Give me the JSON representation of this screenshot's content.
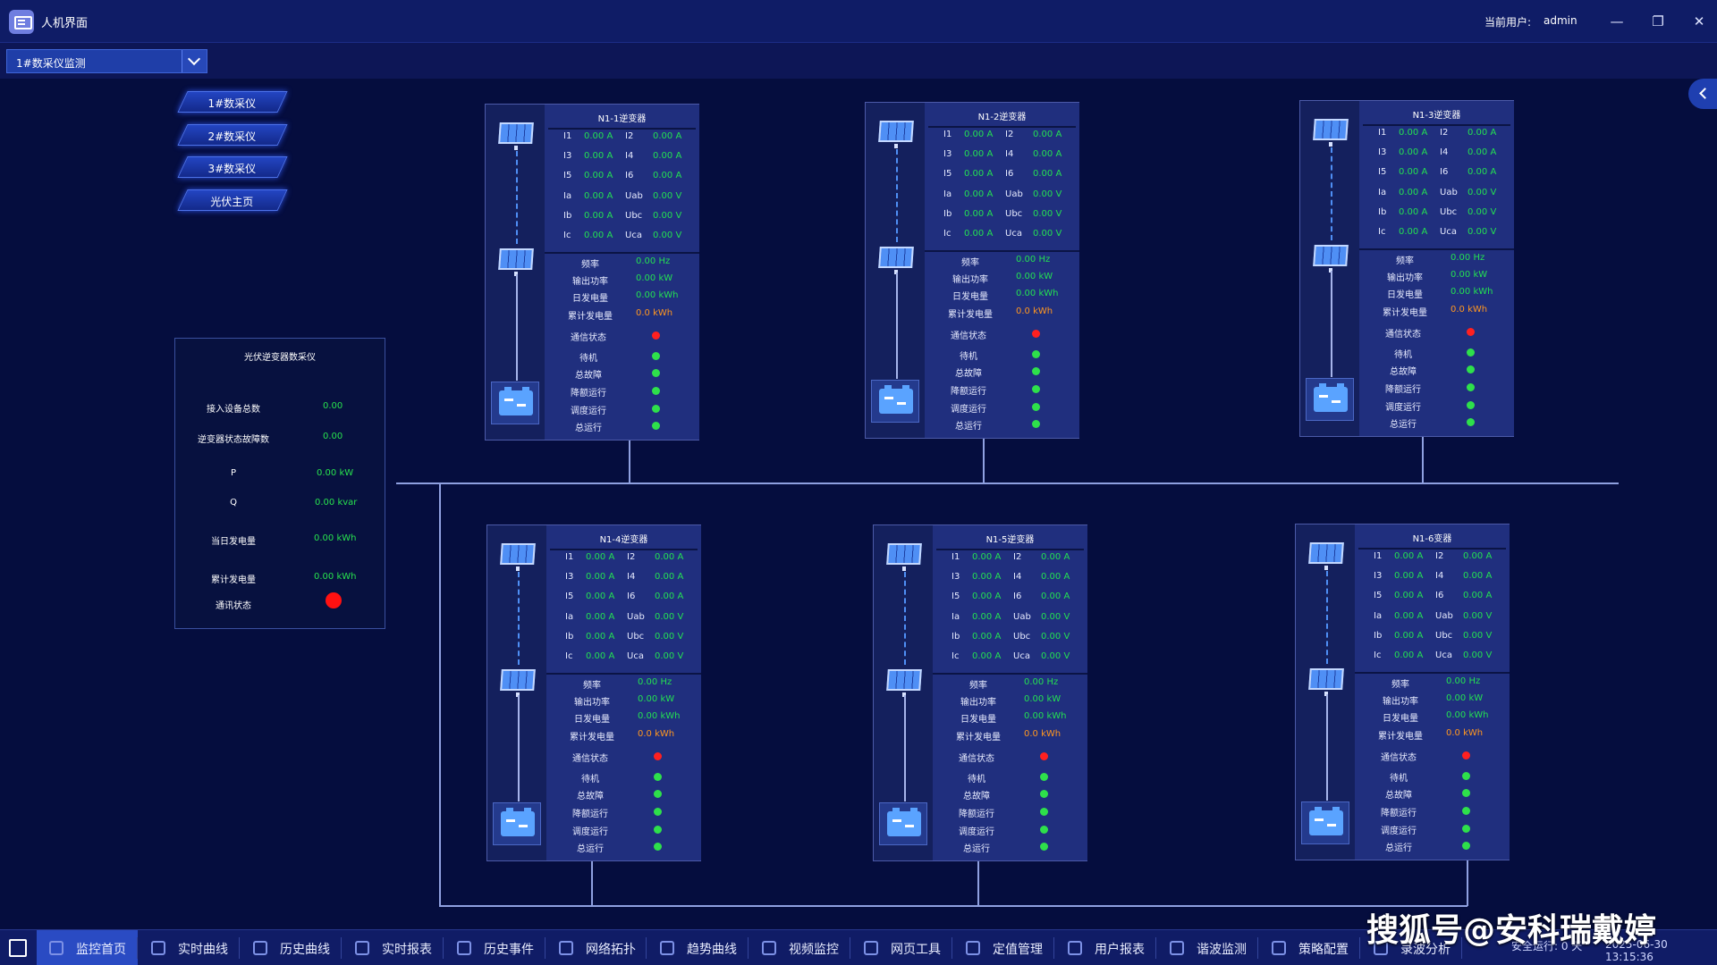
{
  "window": {
    "title": "人机界面",
    "user_label": "当前用户:",
    "user_name": "admin"
  },
  "selector": {
    "value": "1#数采仪监测"
  },
  "nav_buttons": [
    {
      "label": "1#数采仪"
    },
    {
      "label": "2#数采仪"
    },
    {
      "label": "3#数采仪"
    },
    {
      "label": "光伏主页"
    }
  ],
  "summary": {
    "title": "光伏逆变器数采仪",
    "rows": [
      {
        "label": "接入设备总数",
        "value": "0.00"
      },
      {
        "label": "逆变器状态故障数",
        "value": "0.00"
      },
      {
        "label": "P",
        "value": "0.00 kW"
      },
      {
        "label": "Q",
        "value": "0.00 kvar"
      },
      {
        "label": "当日发电量",
        "value": "0.00 kWh"
      },
      {
        "label": "累计发电量",
        "value": "0.00 kWh"
      },
      {
        "label": "通讯状态",
        "value": ""
      }
    ],
    "status_color": "#ff1111"
  },
  "devices": [
    {
      "title": "N1-1逆变器",
      "measurements": [
        {
          "l": "I1",
          "v": "0.00 A",
          "l2": "I2",
          "v2": "0.00 A"
        },
        {
          "l": "I3",
          "v": "0.00 A",
          "l2": "I4",
          "v2": "0.00 A"
        },
        {
          "l": "I5",
          "v": "0.00 A",
          "l2": "I6",
          "v2": "0.00 A"
        },
        {
          "l": "Ia",
          "v": "0.00 A",
          "l2": "Uab",
          "v2": "0.00 V"
        },
        {
          "l": "Ib",
          "v": "0.00 A",
          "l2": "Ubc",
          "v2": "0.00 V"
        },
        {
          "l": "Ic",
          "v": "0.00 A",
          "l2": "Uca",
          "v2": "0.00 V"
        }
      ],
      "energy": [
        {
          "l": "频率",
          "v": "0.00 Hz"
        },
        {
          "l": "输出功率",
          "v": "0.00 kW"
        },
        {
          "l": "日发电量",
          "v": "0.00 kWh"
        },
        {
          "l": "累计发电量",
          "v": "0.0 kWh"
        }
      ],
      "states": [
        "通信状态",
        "待机",
        "总故障",
        "降额运行",
        "调度运行",
        "总运行"
      ]
    },
    {
      "title": "N1-2逆变器",
      "measurements": [
        {
          "l": "I1",
          "v": "0.00 A",
          "l2": "I2",
          "v2": "0.00 A"
        },
        {
          "l": "I3",
          "v": "0.00 A",
          "l2": "I4",
          "v2": "0.00 A"
        },
        {
          "l": "I5",
          "v": "0.00 A",
          "l2": "I6",
          "v2": "0.00 A"
        },
        {
          "l": "Ia",
          "v": "0.00 A",
          "l2": "Uab",
          "v2": "0.00 V"
        },
        {
          "l": "Ib",
          "v": "0.00 A",
          "l2": "Ubc",
          "v2": "0.00 V"
        },
        {
          "l": "Ic",
          "v": "0.00 A",
          "l2": "Uca",
          "v2": "0.00 V"
        }
      ],
      "energy": [
        {
          "l": "频率",
          "v": "0.00 Hz"
        },
        {
          "l": "输出功率",
          "v": "0.00 kW"
        },
        {
          "l": "日发电量",
          "v": "0.00 kWh"
        },
        {
          "l": "累计发电量",
          "v": "0.0 kWh"
        }
      ],
      "states": [
        "通信状态",
        "待机",
        "总故障",
        "降额运行",
        "调度运行",
        "总运行"
      ]
    },
    {
      "title": "N1-3逆变器",
      "measurements": [
        {
          "l": "I1",
          "v": "0.00 A",
          "l2": "I2",
          "v2": "0.00 A"
        },
        {
          "l": "I3",
          "v": "0.00 A",
          "l2": "I4",
          "v2": "0.00 A"
        },
        {
          "l": "I5",
          "v": "0.00 A",
          "l2": "I6",
          "v2": "0.00 A"
        },
        {
          "l": "Ia",
          "v": "0.00 A",
          "l2": "Uab",
          "v2": "0.00 V"
        },
        {
          "l": "Ib",
          "v": "0.00 A",
          "l2": "Ubc",
          "v2": "0.00 V"
        },
        {
          "l": "Ic",
          "v": "0.00 A",
          "l2": "Uca",
          "v2": "0.00 V"
        }
      ],
      "energy": [
        {
          "l": "频率",
          "v": "0.00 Hz"
        },
        {
          "l": "输出功率",
          "v": "0.00 kW"
        },
        {
          "l": "日发电量",
          "v": "0.00 kWh"
        },
        {
          "l": "累计发电量",
          "v": "0.0 kWh"
        }
      ],
      "states": [
        "通信状态",
        "待机",
        "总故障",
        "降额运行",
        "调度运行",
        "总运行"
      ]
    },
    {
      "title": "N1-4逆变器",
      "measurements": [
        {
          "l": "I1",
          "v": "0.00 A",
          "l2": "I2",
          "v2": "0.00 A"
        },
        {
          "l": "I3",
          "v": "0.00 A",
          "l2": "I4",
          "v2": "0.00 A"
        },
        {
          "l": "I5",
          "v": "0.00 A",
          "l2": "I6",
          "v2": "0.00 A"
        },
        {
          "l": "Ia",
          "v": "0.00 A",
          "l2": "Uab",
          "v2": "0.00 V"
        },
        {
          "l": "Ib",
          "v": "0.00 A",
          "l2": "Ubc",
          "v2": "0.00 V"
        },
        {
          "l": "Ic",
          "v": "0.00 A",
          "l2": "Uca",
          "v2": "0.00 V"
        }
      ],
      "energy": [
        {
          "l": "频率",
          "v": "0.00 Hz"
        },
        {
          "l": "输出功率",
          "v": "0.00 kW"
        },
        {
          "l": "日发电量",
          "v": "0.00 kWh"
        },
        {
          "l": "累计发电量",
          "v": "0.0 kWh"
        }
      ],
      "states": [
        "通信状态",
        "待机",
        "总故障",
        "降额运行",
        "调度运行",
        "总运行"
      ]
    },
    {
      "title": "N1-5逆变器",
      "measurements": [
        {
          "l": "I1",
          "v": "0.00 A",
          "l2": "I2",
          "v2": "0.00 A"
        },
        {
          "l": "I3",
          "v": "0.00 A",
          "l2": "I4",
          "v2": "0.00 A"
        },
        {
          "l": "I5",
          "v": "0.00 A",
          "l2": "I6",
          "v2": "0.00 A"
        },
        {
          "l": "Ia",
          "v": "0.00 A",
          "l2": "Uab",
          "v2": "0.00 V"
        },
        {
          "l": "Ib",
          "v": "0.00 A",
          "l2": "Ubc",
          "v2": "0.00 V"
        },
        {
          "l": "Ic",
          "v": "0.00 A",
          "l2": "Uca",
          "v2": "0.00 V"
        }
      ],
      "energy": [
        {
          "l": "频率",
          "v": "0.00 Hz"
        },
        {
          "l": "输出功率",
          "v": "0.00 kW"
        },
        {
          "l": "日发电量",
          "v": "0.00 kWh"
        },
        {
          "l": "累计发电量",
          "v": "0.0 kWh"
        }
      ],
      "states": [
        "通信状态",
        "待机",
        "总故障",
        "降额运行",
        "调度运行",
        "总运行"
      ]
    },
    {
      "title": "N1-6变器",
      "measurements": [
        {
          "l": "I1",
          "v": "0.00 A",
          "l2": "I2",
          "v2": "0.00 A"
        },
        {
          "l": "I3",
          "v": "0.00 A",
          "l2": "I4",
          "v2": "0.00 A"
        },
        {
          "l": "I5",
          "v": "0.00 A",
          "l2": "I6",
          "v2": "0.00 A"
        },
        {
          "l": "Ia",
          "v": "0.00 A",
          "l2": "Uab",
          "v2": "0.00 V"
        },
        {
          "l": "Ib",
          "v": "0.00 A",
          "l2": "Ubc",
          "v2": "0.00 V"
        },
        {
          "l": "Ic",
          "v": "0.00 A",
          "l2": "Uca",
          "v2": "0.00 V"
        }
      ],
      "energy": [
        {
          "l": "频率",
          "v": "0.00 Hz"
        },
        {
          "l": "输出功率",
          "v": "0.00 kW"
        },
        {
          "l": "日发电量",
          "v": "0.00 kWh"
        },
        {
          "l": "累计发电量",
          "v": "0.0 kWh"
        }
      ],
      "states": [
        "通信状态",
        "待机",
        "总故障",
        "降额运行",
        "调度运行",
        "总运行"
      ]
    }
  ],
  "state_colors": [
    "#ff2020",
    "#2ee04b",
    "#2ee04b",
    "#2ee04b",
    "#2ee04b",
    "#2ee04b"
  ],
  "taskbar": [
    {
      "label": "监控首页",
      "icon": "home-icon",
      "active": true
    },
    {
      "label": "实时曲线",
      "icon": "line-chart-icon"
    },
    {
      "label": "历史曲线",
      "icon": "history-chart-icon"
    },
    {
      "label": "实时报表",
      "icon": "report-icon"
    },
    {
      "label": "历史事件",
      "icon": "event-icon"
    },
    {
      "label": "网络拓扑",
      "icon": "topology-icon"
    },
    {
      "label": "趋势曲线",
      "icon": "trend-icon"
    },
    {
      "label": "视频监控",
      "icon": "video-icon"
    },
    {
      "label": "网页工具",
      "icon": "web-icon"
    },
    {
      "label": "定值管理",
      "icon": "setting-icon"
    },
    {
      "label": "用户报表",
      "icon": "user-report-icon"
    },
    {
      "label": "谐波监测",
      "icon": "harmonic-icon"
    },
    {
      "label": "策略配置",
      "icon": "strategy-icon"
    },
    {
      "label": "录波分析",
      "icon": "waveform-icon"
    }
  ],
  "status": {
    "safe_run": "安全运行: 0 天",
    "clock": "2025-06-30 13:15:36"
  },
  "watermark": "搜狐号@安科瑞戴婷"
}
